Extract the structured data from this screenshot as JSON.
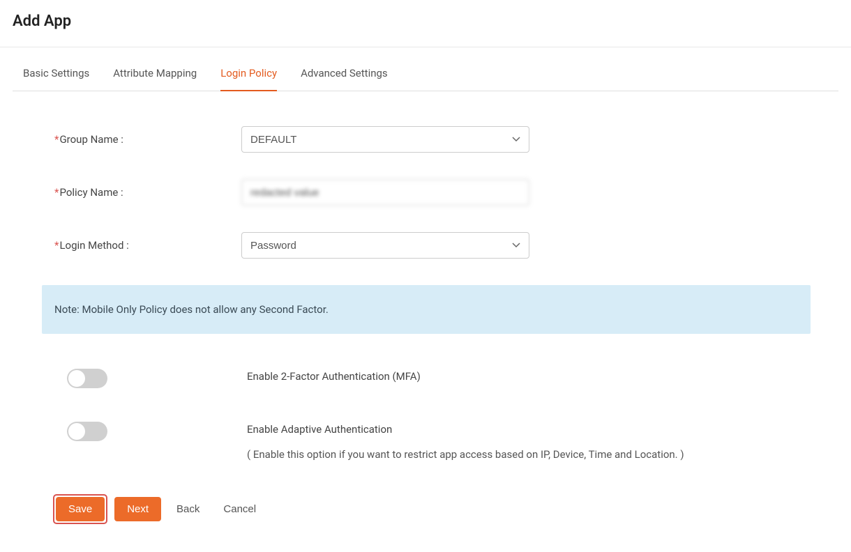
{
  "header": {
    "title": "Add App"
  },
  "tabs": [
    {
      "label": "Basic Settings",
      "active": false
    },
    {
      "label": "Attribute Mapping",
      "active": false
    },
    {
      "label": "Login Policy",
      "active": true
    },
    {
      "label": "Advanced Settings",
      "active": false
    }
  ],
  "form": {
    "group_name": {
      "label": "Group Name :",
      "value": "DEFAULT"
    },
    "policy_name": {
      "label": "Policy Name :",
      "value": "redacted value"
    },
    "login_method": {
      "label": "Login Method :",
      "value": "Password"
    }
  },
  "note": "Note: Mobile Only Policy does not allow any Second Factor.",
  "toggles": {
    "mfa": {
      "label": "Enable 2-Factor Authentication (MFA)",
      "on": false
    },
    "adaptive": {
      "label": "Enable Adaptive Authentication",
      "sub": "( Enable this option if you want to restrict app access based on IP, Device, Time and Location. )",
      "on": false
    }
  },
  "buttons": {
    "save": "Save",
    "next": "Next",
    "back": "Back",
    "cancel": "Cancel"
  }
}
